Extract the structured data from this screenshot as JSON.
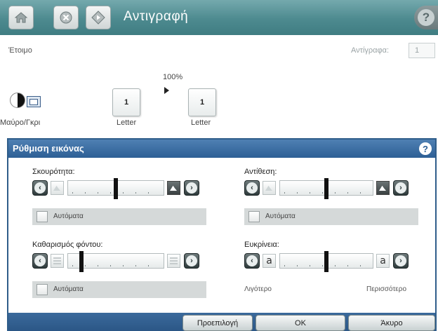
{
  "topbar": {
    "title": "Αντιγραφή",
    "home_icon": "home-icon",
    "stop_icon": "stop-icon",
    "start_icon": "start-icon",
    "help_icon": "help-icon",
    "help_glyph": "?",
    "color": "#4d8a8f"
  },
  "status": {
    "text": "Έτοιμο",
    "copies_label": "Αντίγραφα:",
    "copies_value": "1"
  },
  "copy_settings": {
    "zoom": "100%",
    "source_pages": "1",
    "source_size": "Letter",
    "output_pages": "1",
    "output_size": "Letter",
    "color_mode": "Μαύρο/Γκρι"
  },
  "dialog": {
    "title": "Ρύθμιση εικόνας",
    "help_glyph": "?",
    "header_color": "#2d5f95",
    "darkness": {
      "label": "Σκουρότητα:",
      "auto_label": "Αυτόματα",
      "level": 0.5,
      "auto_checked": false
    },
    "contrast": {
      "label": "Αντίθεση:",
      "auto_label": "Αυτόματα",
      "level": 0.5,
      "auto_checked": false
    },
    "background_cleanup": {
      "label": "Καθαρισμός φόντου:",
      "auto_label": "Αυτόματα",
      "level": 0.12,
      "auto_checked": false
    },
    "sharpness": {
      "label": "Ευκρίνεια:",
      "icon_letter": "a",
      "min_label": "Λιγότερο",
      "max_label": "Περισσότερο",
      "level": 0.5
    },
    "buttons": {
      "preview": "Προεπιλογή",
      "ok": "OK",
      "cancel": "Άκυρο"
    }
  }
}
